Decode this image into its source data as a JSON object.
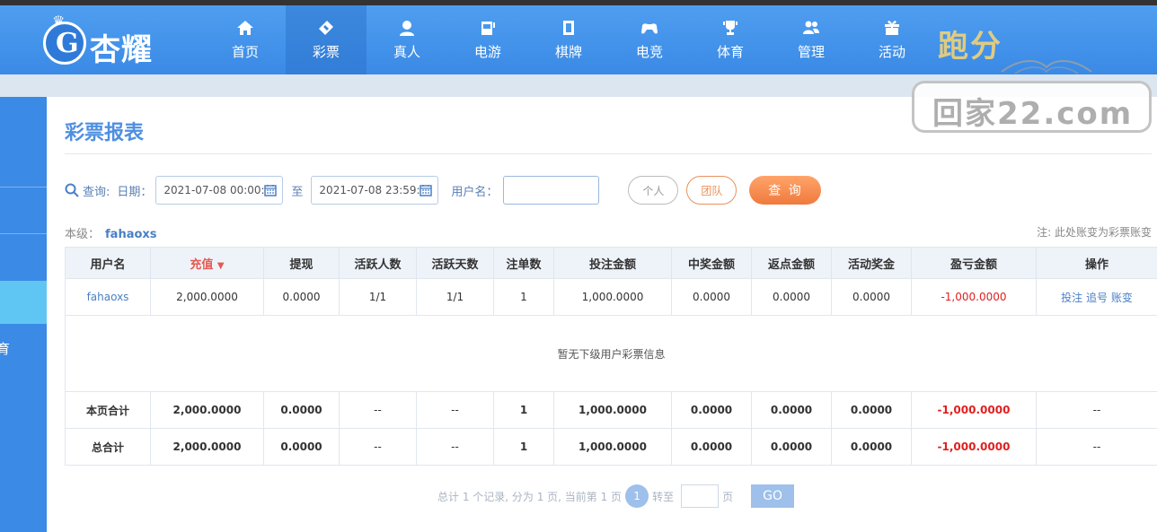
{
  "brand": {
    "name": "杏耀"
  },
  "nav": [
    {
      "label": "首页",
      "icon": "home-icon"
    },
    {
      "label": "彩票",
      "icon": "lottery-icon",
      "active": true
    },
    {
      "label": "真人",
      "icon": "live-dealer-icon"
    },
    {
      "label": "电游",
      "icon": "slot-machine-icon"
    },
    {
      "label": "棋牌",
      "icon": "mahjong-icon"
    },
    {
      "label": "电竞",
      "icon": "gamepad-icon"
    },
    {
      "label": "体育",
      "icon": "trophy-icon"
    },
    {
      "label": "管理",
      "icon": "users-icon"
    },
    {
      "label": "活动",
      "icon": "gift-icon"
    }
  ],
  "watermark": {
    "top": "跑分",
    "box": "回家22.com"
  },
  "sidebar": {
    "partial_text": "育"
  },
  "page": {
    "title": "彩票报表"
  },
  "query": {
    "label": "查询:",
    "date_label": "日期：",
    "date_from": "2021-07-08 00:00:00",
    "to_label": "至",
    "date_to": "2021-07-08 23:59:59",
    "username_label": "用户名：",
    "username_value": "",
    "personal_btn": "个人",
    "team_btn": "团队",
    "search_btn": "查 询"
  },
  "level": {
    "label": "本级：",
    "user": "fahaoxs"
  },
  "note": "注: 此处账变为彩票账变",
  "colors": {
    "primary": "#3a8ae6",
    "title": "#4f8fe0",
    "negative": "#e02020",
    "accent": "#f07a3d"
  },
  "table": {
    "headers": [
      "用户名",
      "充值",
      "提现",
      "活跃人数",
      "活跃天数",
      "注单数",
      "投注金额",
      "中奖金额",
      "返点金额",
      "活动奖金",
      "盈亏金额",
      "操作"
    ],
    "sort_indicator": "▼",
    "row": {
      "username": "fahaoxs",
      "recharge": "2,000.0000",
      "withdraw": "0.0000",
      "active_users": "1/1",
      "active_days": "1/1",
      "orders": "1",
      "bet_amount": "1,000.0000",
      "win_amount": "0.0000",
      "rebate": "0.0000",
      "bonus": "0.0000",
      "profit": "-1,000.0000",
      "ops": [
        "投注",
        "追号",
        "账变"
      ]
    },
    "empty_text": "暂无下级用户彩票信息",
    "page_total": {
      "label": "本页合计",
      "recharge": "2,000.0000",
      "withdraw": "0.0000",
      "active_users": "--",
      "active_days": "--",
      "orders": "1",
      "bet_amount": "1,000.0000",
      "win_amount": "0.0000",
      "rebate": "0.0000",
      "bonus": "0.0000",
      "profit": "-1,000.0000",
      "ops": "--"
    },
    "grand_total": {
      "label": "总合计",
      "recharge": "2,000.0000",
      "withdraw": "0.0000",
      "active_users": "--",
      "active_days": "--",
      "orders": "1",
      "bet_amount": "1,000.0000",
      "win_amount": "0.0000",
      "rebate": "0.0000",
      "bonus": "0.0000",
      "profit": "-1,000.0000",
      "ops": "--"
    }
  },
  "pager": {
    "summary": "总计 1 个记录, 分为 1 页, 当前第 1 页",
    "current": "1",
    "goto_label": "转至",
    "page_suffix": "页",
    "go_btn": "GO"
  }
}
